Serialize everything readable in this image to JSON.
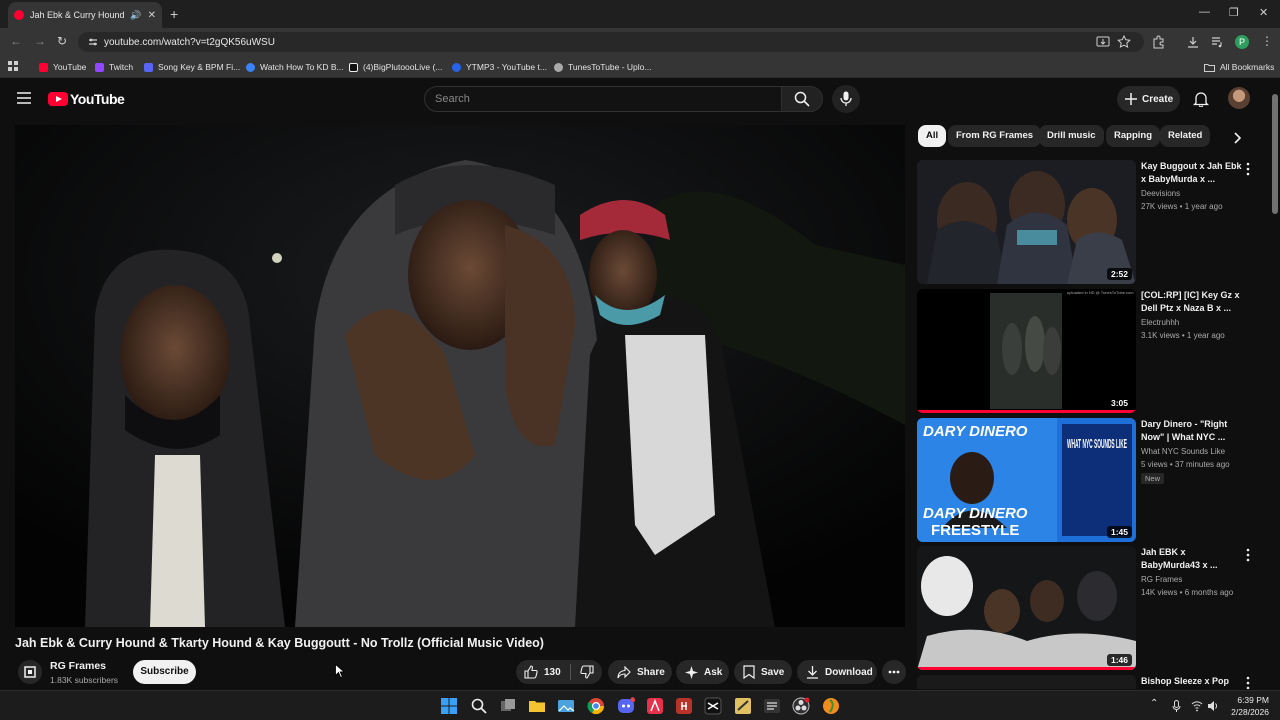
{
  "browser": {
    "tab_title": "Jah Ebk & Curry Hound & T",
    "url": "youtube.com/watch?v=t2gQK56uWSU",
    "profile_initial": "P",
    "bookmarks": [
      {
        "label": "YouTube",
        "color": "#ff0033"
      },
      {
        "label": "Twitch",
        "color": "#9146ff"
      },
      {
        "label": "Song Key & BPM Fi...",
        "color": "#5865f2"
      },
      {
        "label": "Watch How To KD B...",
        "color": "#3b82f6"
      },
      {
        "label": "(4)BigPlutoooLive (...",
        "color": "#eeeeee"
      },
      {
        "label": "YTMP3 - YouTube t...",
        "color": "#2563eb"
      },
      {
        "label": "TunesToTube - Uplo...",
        "color": "#aaaaaa"
      }
    ],
    "all_bookmarks": "All Bookmarks"
  },
  "youtube": {
    "logo_text": "YouTube",
    "search_placeholder": "Search",
    "create_label": "Create"
  },
  "video": {
    "title": "Jah Ebk & Curry Hound & Tkarty Hound & Kay Buggoutt - No Trollz (Official Music Video)",
    "channel": "RG Frames",
    "subscribers": "1.83K subscribers",
    "subscribe_label": "Subscribe",
    "likes": "130",
    "share_label": "Share",
    "ask_label": "Ask",
    "save_label": "Save",
    "download_label": "Download"
  },
  "chips": [
    "All",
    "From RG Frames",
    "Drill music",
    "Rapping",
    "Related"
  ],
  "recommendations": [
    {
      "title": "Kay Buggout x Jah Ebk x BabyMurda x ...",
      "channel": "Deevisions",
      "meta": "27K views • 1 year ago",
      "duration": "2:52",
      "new": ""
    },
    {
      "title": "[COL:RP] [IC] Key Gz x Dell Ptz x Naza B x ...",
      "channel": "Electruhhh",
      "meta": "3.1K views • 1 year ago",
      "duration": "3:05",
      "new": ""
    },
    {
      "title": "Dary Dinero - \"Right Now\" | What NYC ...",
      "channel": "What NYC Sounds Like",
      "meta": "5 views • 37 minutes ago",
      "duration": "1:45",
      "new": "New"
    },
    {
      "title": "Jah EBK x BabyMurda43 x ...",
      "channel": "RG Frames",
      "meta": "14K views • 6 months ago",
      "duration": "1:46",
      "new": ""
    },
    {
      "title": "Bishop Sleeze x Pop",
      "channel": "",
      "meta": "",
      "duration": "",
      "new": ""
    }
  ],
  "thumb_text": {
    "uploaded": "uploaded in HD @ TunesToTube.com",
    "dary": "DARY DINERO",
    "dary2": "DARY DINERO",
    "freestyle": "FREESTYLE",
    "what_nyc": "WHAT NYC SOUNDS LIKE"
  },
  "taskbar": {
    "time": "6:39 PM",
    "date": "2/28/2026"
  }
}
